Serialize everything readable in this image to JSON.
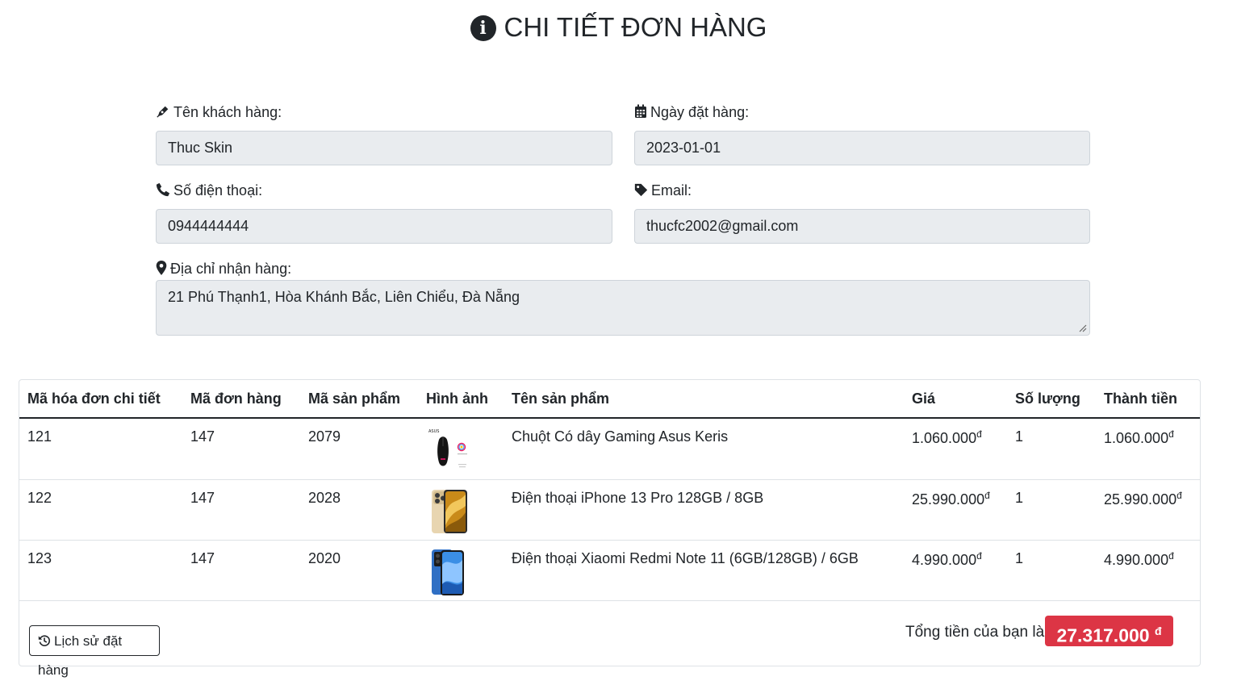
{
  "page": {
    "title": "CHI TIẾT ĐƠN HÀNG"
  },
  "form": {
    "customer_name_label": "Tên khách hàng:",
    "customer_name_value": "Thuc Skin",
    "order_date_label": "Ngày đặt hàng:",
    "order_date_value": "2023-01-01",
    "phone_label": "Số điện thoại:",
    "phone_value": "0944444444",
    "email_label": "Email:",
    "email_value": "thucfc2002@gmail.com",
    "address_label": "Địa chỉ nhận hàng:",
    "address_value": "21 Phú Thạnh1, Hòa Khánh Bắc, Liên Chiểu, Đà Nẵng"
  },
  "table": {
    "headers": [
      "Mã hóa đơn chi tiết",
      "Mã đơn hàng",
      "Mã sản phẩm",
      "Hình ảnh",
      "Tên sản phẩm",
      "Giá",
      "Số lượng",
      "Thành tiền"
    ],
    "currency_symbol": "đ",
    "rows": [
      {
        "detail_id": "121",
        "order_id": "147",
        "product_id": "2079",
        "image": "mouse-image",
        "name": "Chuột Có dây Gaming Asus Keris",
        "price": "1.060.000",
        "qty": "1",
        "subtotal": "1.060.000"
      },
      {
        "detail_id": "122",
        "order_id": "147",
        "product_id": "2028",
        "image": "iphone-image",
        "name": "Điện thoại iPhone 13 Pro 128GB / 8GB",
        "price": "25.990.000",
        "qty": "1",
        "subtotal": "25.990.000"
      },
      {
        "detail_id": "123",
        "order_id": "147",
        "product_id": "2020",
        "image": "xiaomi-phone-image",
        "name": "Điện thoại Xiaomi Redmi Note 11 (6GB/128GB) / 6GB",
        "price": "4.990.000",
        "qty": "1",
        "subtotal": "4.990.000"
      }
    ]
  },
  "footer": {
    "history_button": "Lịch sử đặt hàng",
    "total_label": "Tổng tiền của bạn là:",
    "total_value": "27.317.000",
    "total_currency": "đ"
  },
  "colors": {
    "accent_danger": "#dc3545",
    "input_bg": "#e9ecef",
    "text": "#212529"
  }
}
